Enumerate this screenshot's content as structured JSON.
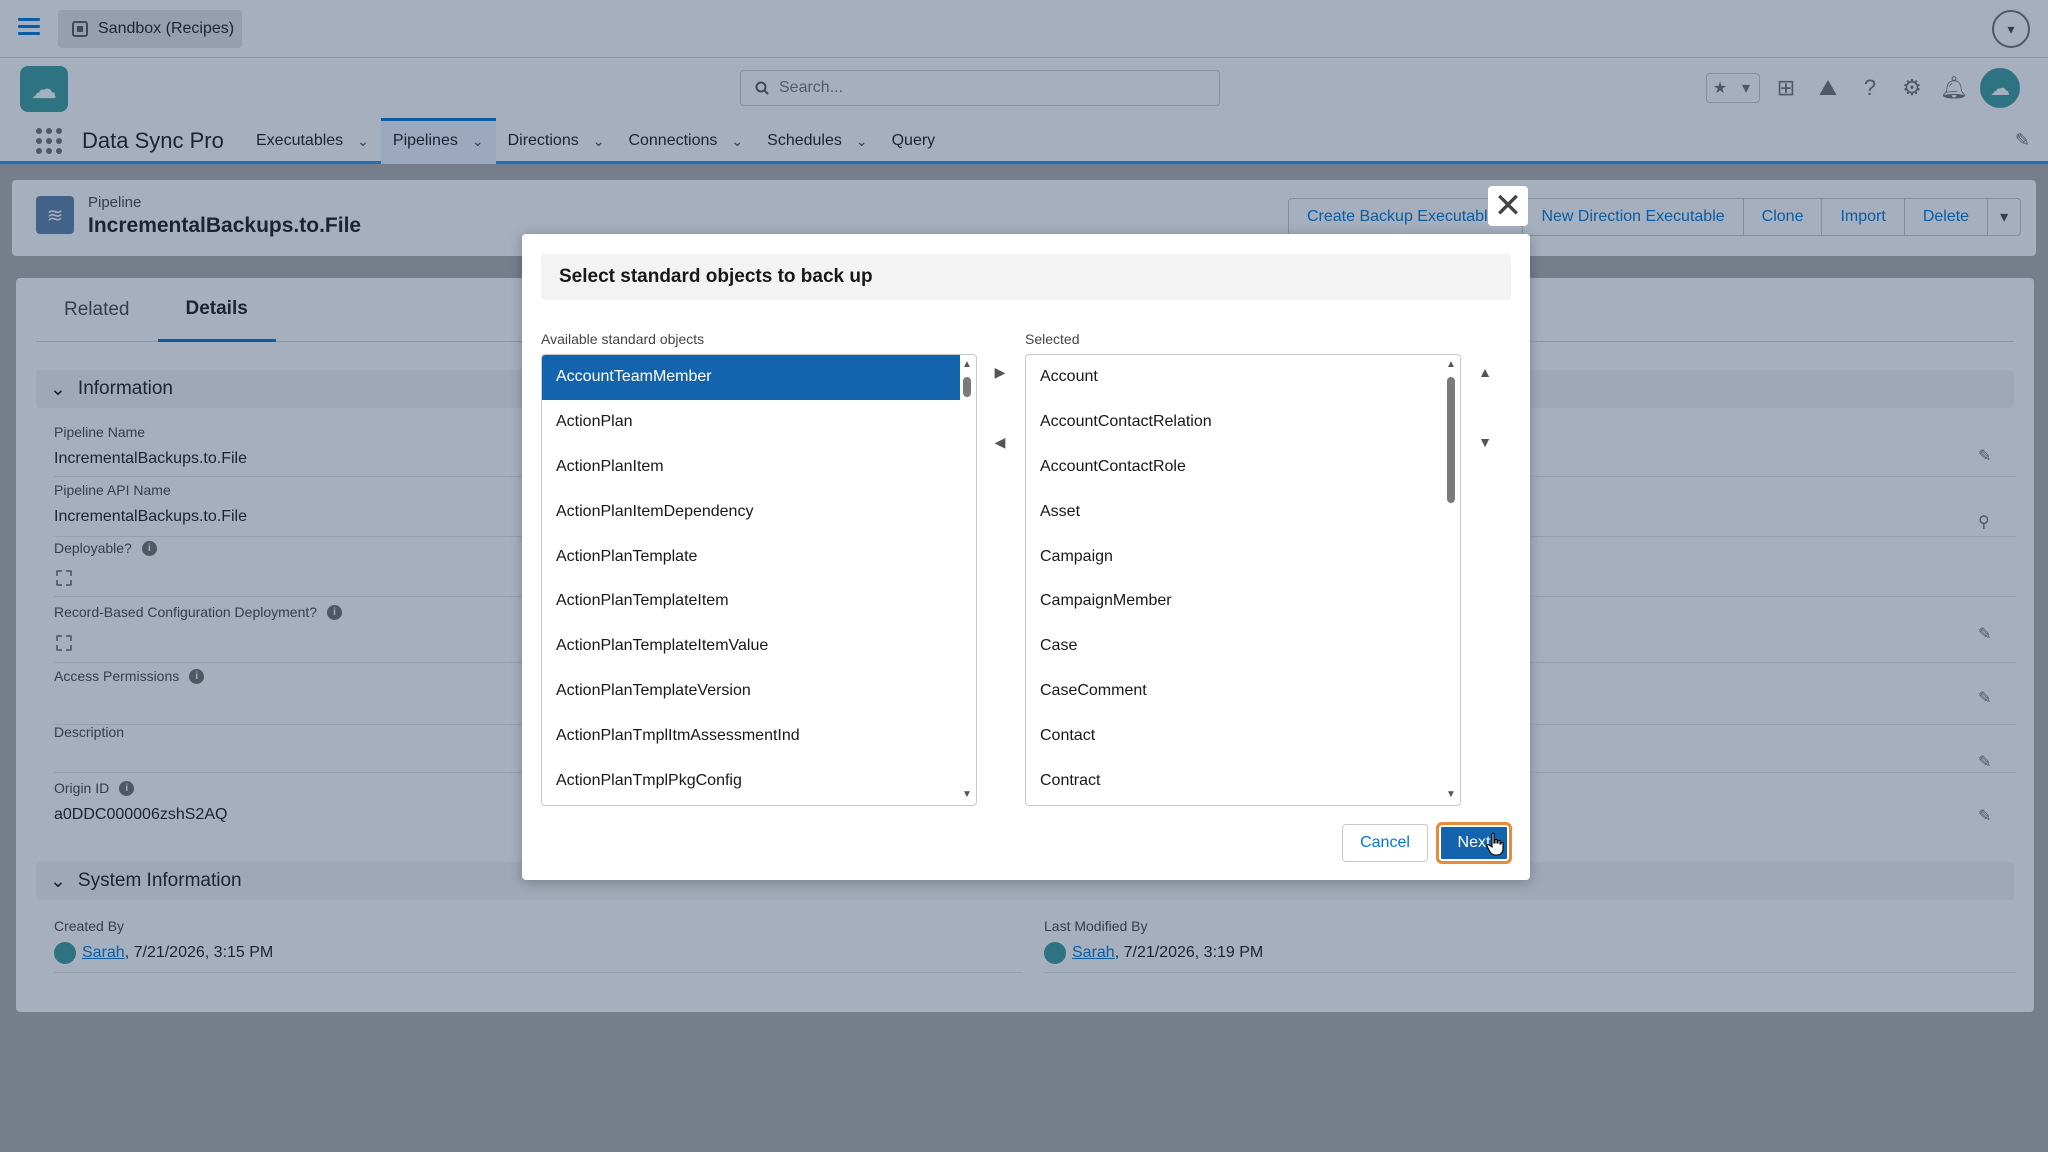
{
  "topbar": {
    "org_label": "Sandbox (Recipes)"
  },
  "header": {
    "search_placeholder": "Search..."
  },
  "nav": {
    "app_name": "Data Sync Pro",
    "items": [
      {
        "label": "Executables",
        "has_menu": true
      },
      {
        "label": "Pipelines",
        "has_menu": true,
        "active": true
      },
      {
        "label": "Directions",
        "has_menu": true
      },
      {
        "label": "Connections",
        "has_menu": true
      },
      {
        "label": "Schedules",
        "has_menu": true
      },
      {
        "label": "Query",
        "has_menu": false
      }
    ]
  },
  "record": {
    "type_label": "Pipeline",
    "name": "IncrementalBackups.to.File",
    "actions": [
      "Create Backup Executables",
      "New Direction Executable",
      "Clone",
      "Import",
      "Delete"
    ]
  },
  "tabs": {
    "related": "Related",
    "details": "Details"
  },
  "information": {
    "section_title": "Information",
    "pipeline_name_label": "Pipeline Name",
    "pipeline_name_value": "IncrementalBackups.to.File",
    "api_name_label": "Pipeline API Name",
    "api_name_value": "IncrementalBackups.to.File",
    "deployable_label": "Deployable?",
    "record_based_label": "Record-Based Configuration Deployment?",
    "access_permissions_label": "Access Permissions",
    "description_label": "Description",
    "origin_id_label": "Origin ID",
    "origin_id_value": "a0DDC000006zshS2AQ"
  },
  "system_information": {
    "section_title": "System Information",
    "created_by_label": "Created By",
    "created_by_user": "Sarah",
    "created_by_date": ", 7/21/2026, 3:15 PM",
    "modified_by_label": "Last Modified By",
    "modified_by_user": "Sarah",
    "modified_by_date": ", 7/21/2026, 3:19 PM"
  },
  "modal": {
    "title": "Select standard objects to back up",
    "available_label": "Available standard objects",
    "selected_label": "Selected",
    "available_options": [
      "AccountTeamMember",
      "ActionPlan",
      "ActionPlanItem",
      "ActionPlanItemDependency",
      "ActionPlanTemplate",
      "ActionPlanTemplateItem",
      "ActionPlanTemplateItemValue",
      "ActionPlanTemplateVersion",
      "ActionPlanTmplItmAssessmentInd",
      "ActionPlanTmplPkgConfig"
    ],
    "available_highlighted": "AccountTeamMember",
    "selected_options": [
      "Account",
      "AccountContactRelation",
      "AccountContactRole",
      "Asset",
      "Campaign",
      "CampaignMember",
      "Case",
      "CaseComment",
      "Contact",
      "Contract"
    ],
    "cancel_label": "Cancel",
    "next_label": "Next"
  },
  "icons": {
    "close": "close-icon",
    "move_right": "arrow-right-icon",
    "move_left": "arrow-left-icon",
    "move_up": "arrow-up-icon",
    "move_down": "arrow-down-icon"
  },
  "colors": {
    "brand_blue": "#0176d3",
    "selected_option_bg": "#1464ad",
    "next_button_focus_ring": "#e58b3a",
    "app_teal": "#3a9b9b"
  }
}
